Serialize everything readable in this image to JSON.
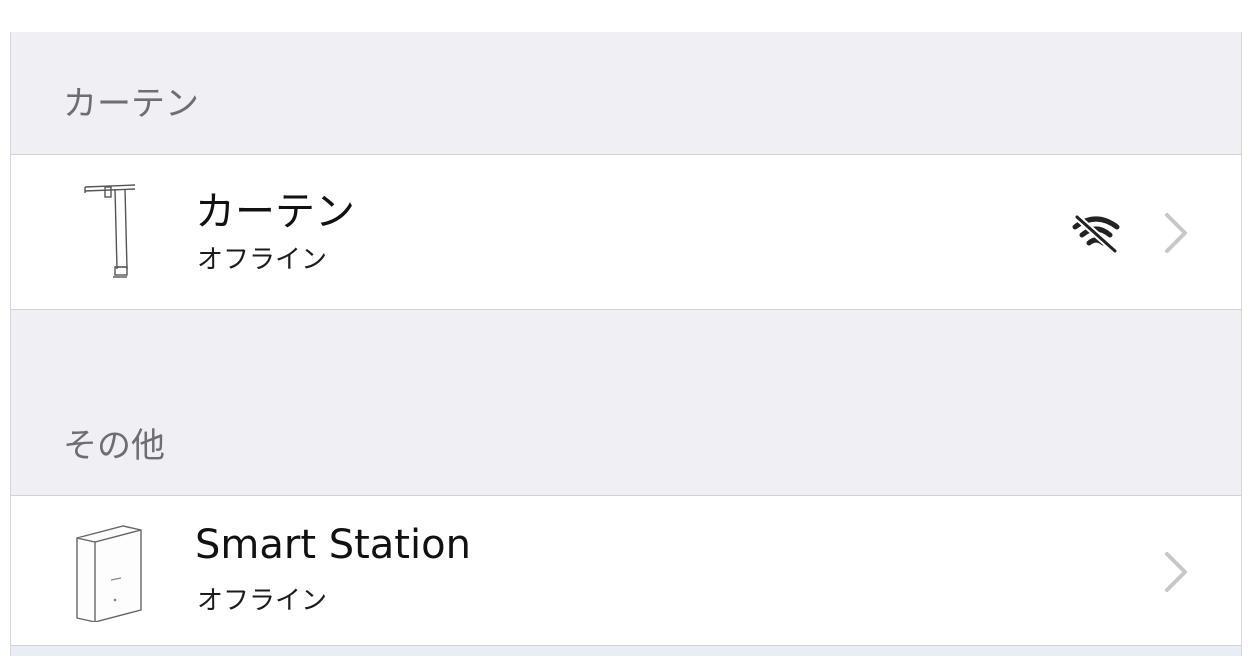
{
  "sections": [
    {
      "header": "カーテン",
      "device": {
        "name": "カーテン",
        "status": "オフライン",
        "icon": "curtain-device-icon",
        "indicator_icon": "wifi-off-icon"
      }
    },
    {
      "header": "その他",
      "device": {
        "name": "Smart Station",
        "status": "オフライン",
        "icon": "smart-station-device-icon"
      }
    }
  ],
  "colors": {
    "background": "#efeff4",
    "row_background": "#ffffff",
    "header_text": "#6d6d72",
    "chevron": "#c7c7cc"
  }
}
